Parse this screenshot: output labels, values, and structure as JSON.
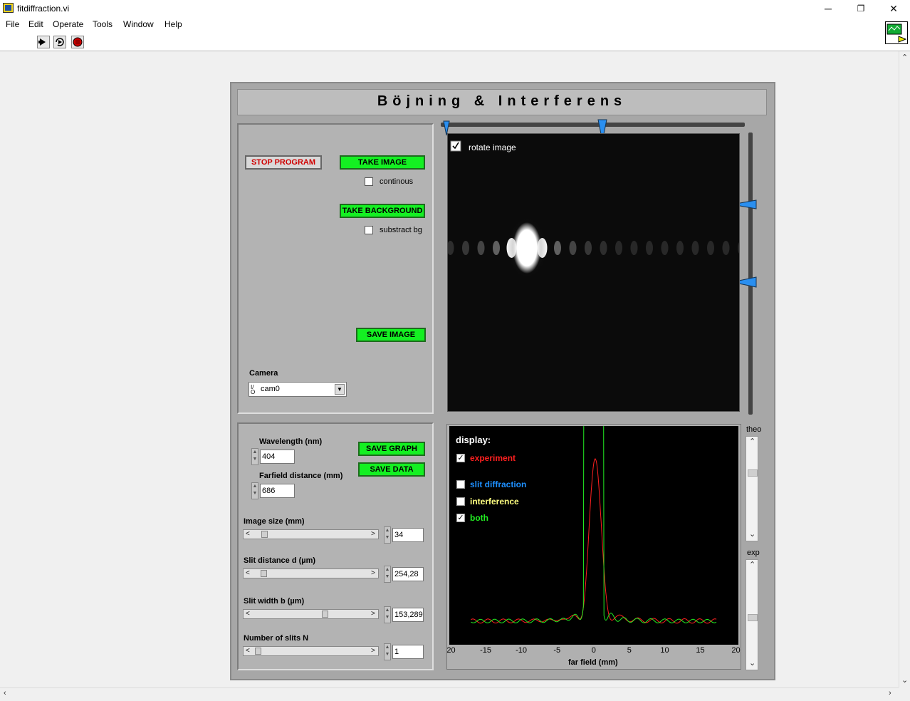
{
  "window": {
    "title": "fitdiffraction.vi",
    "minimize": "─",
    "maximize": "❐",
    "close": "✕"
  },
  "menu": [
    "File",
    "Edit",
    "Operate",
    "Tools",
    "Window",
    "Help"
  ],
  "toolbar": {
    "run_icon": "run-arrow-icon",
    "run_continuous_icon": "run-continuously-icon",
    "abort_icon": "abort-stop-icon"
  },
  "panel": {
    "heading": "Böjning & Interferens",
    "stop_program": "STOP PROGRAM",
    "take_image": "TAKE IMAGE",
    "continous_label": "continous",
    "take_background": "TAKE BACKGROUND",
    "substract_bg_label": "substract bg",
    "save_image": "SAVE IMAGE",
    "camera_label": "Camera",
    "camera_value": "cam0",
    "camera_prefix": "I/O",
    "rotate_image_label": "rotate image",
    "rotate_image_checked": true,
    "continous_checked": false,
    "substract_bg_checked": false
  },
  "params": {
    "wavelength_label": "Wavelength (nm)",
    "wavelength_value": "404",
    "farfield_label": "Farfield distance (mm)",
    "farfield_value": "686",
    "save_graph": "SAVE GRAPH",
    "save_data": "SAVE DATA",
    "image_size_label": "Image size (mm)",
    "image_size_value": "34",
    "slit_distance_label": "Slit distance d (µm)",
    "slit_distance_value": "254,28",
    "slit_width_label": "Slit width b (µm)",
    "slit_width_value": "153,289",
    "num_slits_label": "Number of slits N",
    "num_slits_value": "1"
  },
  "graph": {
    "display_label": "display:",
    "experiment_label": "experiment",
    "experiment_checked": true,
    "slit_diffraction_label": "slit diffraction",
    "slit_diffraction_checked": false,
    "interference_label": "interference",
    "interference_checked": false,
    "both_label": "both",
    "both_checked": true,
    "x_axis_label": "far field (mm)",
    "x_ticks": [
      "20",
      "-15",
      "-10",
      "-5",
      "0",
      "5",
      "10",
      "15",
      "20"
    ],
    "theo_label": "theo",
    "exp_label": "exp",
    "colors": {
      "experiment": "#ff2020",
      "slit_diffraction": "#1e90ff",
      "interference": "#ffff80",
      "both": "#22ee22"
    }
  }
}
